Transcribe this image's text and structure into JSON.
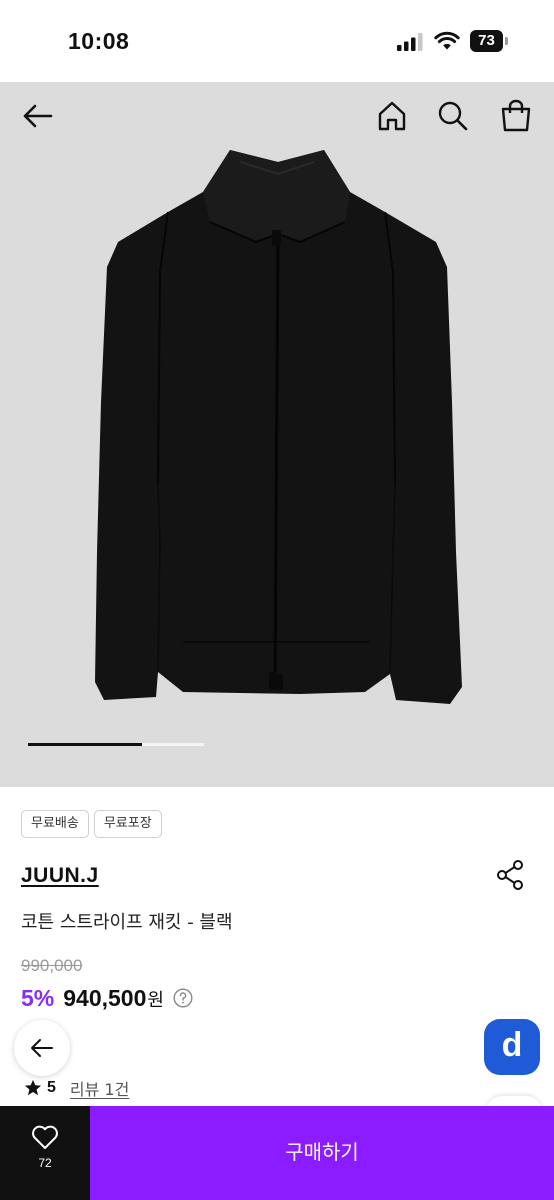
{
  "status_bar": {
    "time": "10:08",
    "battery": "73"
  },
  "header": {
    "icons": [
      "back-arrow-icon",
      "home-icon",
      "search-icon",
      "shopping-bag-icon"
    ]
  },
  "gallery": {
    "progress_fraction": 0.65
  },
  "product": {
    "tags": [
      "무료배송",
      "무료포장"
    ],
    "brand": "JUUN.J",
    "name": "코튼 스트라이프 재킷 - 블랙",
    "original_price": "990,000",
    "discount": "5%",
    "price": "940,500",
    "currency": "원",
    "rating": "5",
    "review_link": "리뷰 1건"
  },
  "floating": {
    "app_badge": "d"
  },
  "bottom_bar": {
    "like_count": "72",
    "buy_label": "구매하기"
  },
  "colors": {
    "accent": "#8b1cff",
    "discount": "#8b2cf5",
    "hero_background": "#dcdcdc",
    "badge_blue": "#1f5bd6"
  }
}
